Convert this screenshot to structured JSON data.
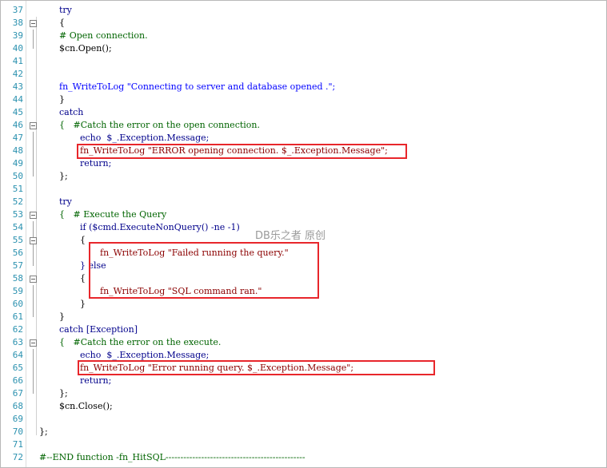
{
  "editor": {
    "lines": [
      {
        "num": "37",
        "text": "try"
      },
      {
        "num": "38",
        "text": "{"
      },
      {
        "num": "39",
        "text": "# Open connection."
      },
      {
        "num": "40",
        "text": "$cn.Open();"
      },
      {
        "num": "41",
        "text": ""
      },
      {
        "num": "42",
        "text": ""
      },
      {
        "num": "43",
        "text": "fn_WriteToLog \"Connecting to server and database opened .\";"
      },
      {
        "num": "44",
        "text": "}"
      },
      {
        "num": "45",
        "text": "catch"
      },
      {
        "num": "46",
        "text": "{   #Catch the error on the open connection."
      },
      {
        "num": "47",
        "text": "echo  $_.Exception.Message;"
      },
      {
        "num": "48",
        "text": "fn_WriteToLog \"ERROR opening connection. $_.Exception.Message\";"
      },
      {
        "num": "49",
        "text": "return;"
      },
      {
        "num": "50",
        "text": "};"
      },
      {
        "num": "51",
        "text": ""
      },
      {
        "num": "52",
        "text": "try"
      },
      {
        "num": "53",
        "text": "{   # Execute the Query"
      },
      {
        "num": "54",
        "text": "if ($cmd.ExecuteNonQuery() -ne -1)"
      },
      {
        "num": "55",
        "text": "{"
      },
      {
        "num": "56",
        "text": "fn_WriteToLog \"Failed running the query.\""
      },
      {
        "num": "57",
        "text": "} else"
      },
      {
        "num": "58",
        "text": "{"
      },
      {
        "num": "59",
        "text": "fn_WriteToLog \"SQL command ran.\""
      },
      {
        "num": "60",
        "text": "}"
      },
      {
        "num": "61",
        "text": "}"
      },
      {
        "num": "62",
        "text": "catch [Exception]"
      },
      {
        "num": "63",
        "text": "{   #Catch the error on the execute."
      },
      {
        "num": "64",
        "text": "echo  $_.Exception.Message;"
      },
      {
        "num": "65",
        "text": "fn_WriteToLog \"Error running query. $_.Exception.Message\";"
      },
      {
        "num": "66",
        "text": "return;"
      },
      {
        "num": "67",
        "text": "};"
      },
      {
        "num": "68",
        "text": "$cn.Close();"
      },
      {
        "num": "69",
        "text": ""
      },
      {
        "num": "70",
        "text": "};"
      },
      {
        "num": "71",
        "text": ""
      },
      {
        "num": "72",
        "text": "#--END function -fn_HitSQL-----------------------------------------------"
      }
    ]
  },
  "watermark": "DB乐之者 原创",
  "colors": {
    "line_number": "#2b91af",
    "keyword": "#00008b",
    "comment": "#006400",
    "string": "#8b0000",
    "variable": "#ff4500",
    "function": "#0000ff",
    "highlight_box": "#e8262b"
  }
}
